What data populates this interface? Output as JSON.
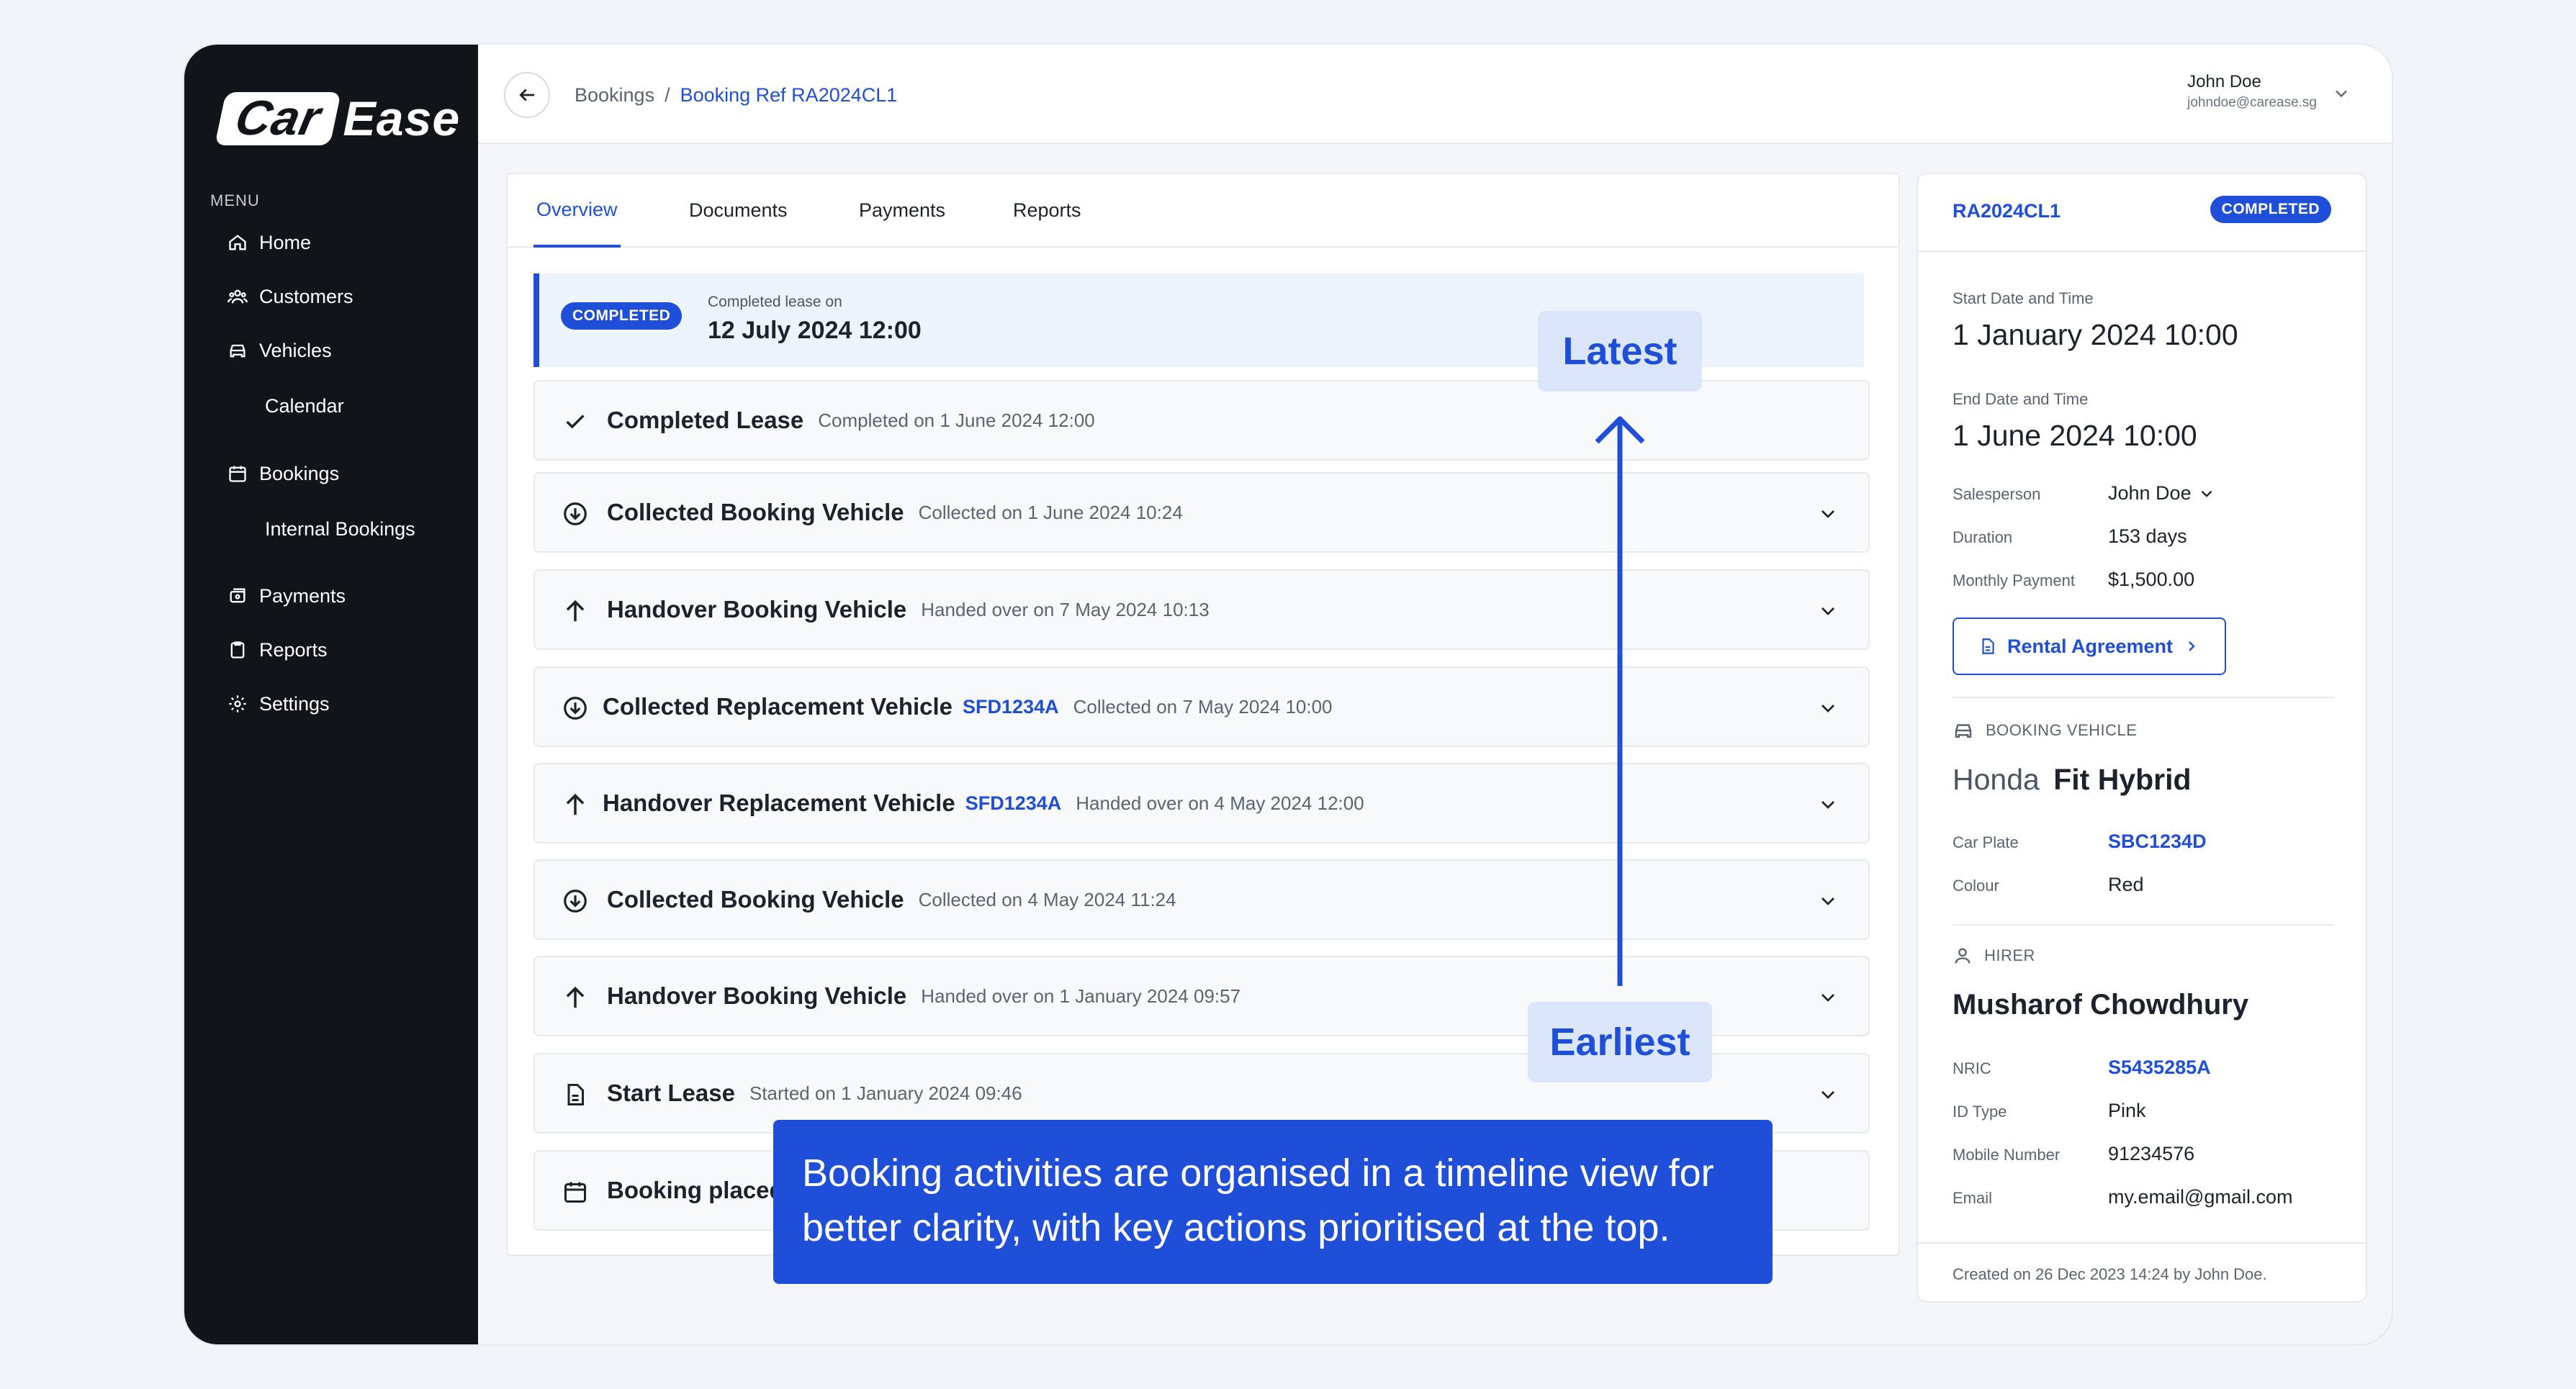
{
  "brand": {
    "car": "Car",
    "ease": "Ease"
  },
  "sidebar": {
    "menu_label": "MENU",
    "items": [
      {
        "label": "Home",
        "icon": "home-icon"
      },
      {
        "label": "Customers",
        "icon": "users-icon"
      },
      {
        "label": "Vehicles",
        "icon": "car-icon"
      },
      {
        "label": "Calendar"
      },
      {
        "label": "Bookings",
        "icon": "calendar-icon"
      },
      {
        "label": "Internal Bookings"
      },
      {
        "label": "Payments",
        "icon": "payments-icon"
      },
      {
        "label": "Reports",
        "icon": "clipboard-icon"
      },
      {
        "label": "Settings",
        "icon": "gear-icon"
      }
    ]
  },
  "header": {
    "breadcrumb": [
      "Bookings",
      "/",
      "Booking Ref RA2024CL1"
    ],
    "user_name": "John Doe",
    "user_email": "johndoe@carease.sg"
  },
  "tabs": [
    "Overview",
    "Documents",
    "Payments",
    "Reports"
  ],
  "status_banner": {
    "badge": "COMPLETED",
    "label": "Completed lease on",
    "date": "12 July 2024 12:00"
  },
  "activities": [
    {
      "icon": "check-icon",
      "title": "Completed Lease",
      "detail": "Completed on 1 June 2024 12:00"
    },
    {
      "icon": "collect-icon",
      "title": "Collected Booking Vehicle",
      "detail": "Collected on 1 June 2024 10:24"
    },
    {
      "icon": "arrow-up-icon",
      "title": "Handover Booking Vehicle",
      "detail": "Handed over on 7 May 2024 10:13"
    },
    {
      "icon": "collect-icon",
      "title": "Collected Replacement Vehicle",
      "plate": "SFD1234A",
      "detail": "Collected on 7 May 2024 10:00"
    },
    {
      "icon": "arrow-up-icon",
      "title": "Handover Replacement Vehicle",
      "plate": "SFD1234A",
      "detail": "Handed over on 4 May 2024 12:00"
    },
    {
      "icon": "collect-icon",
      "title": "Collected Booking Vehicle",
      "detail": "Collected on 4 May 2024 11:24"
    },
    {
      "icon": "arrow-up-icon",
      "title": "Handover Booking Vehicle",
      "detail": "Handed over on 1 January 2024 09:57"
    },
    {
      "icon": "document-icon",
      "title": "Start Lease",
      "detail": "Started on 1 January 2024 09:46"
    },
    {
      "icon": "calendar-icon",
      "title": "Booking placed"
    }
  ],
  "details": {
    "ref": "RA2024CL1",
    "badge": "COMPLETED",
    "start_label": "Start Date and Time",
    "start_value": "1 January 2024 10:00",
    "end_label": "End Date and Time",
    "end_value": "1 June 2024 10:00",
    "salesperson_label": "Salesperson",
    "salesperson_value": "John Doe",
    "duration_label": "Duration",
    "duration_value": "153 days",
    "monthly_label": "Monthly Payment",
    "monthly_value": "$1,500.00",
    "agreement_label": "Rental Agreement",
    "vehicle_section": "BOOKING VEHICLE",
    "vehicle_make": "Honda",
    "vehicle_model": "Fit Hybrid",
    "plate_label": "Car Plate",
    "plate_value": "SBC1234D",
    "colour_label": "Colour",
    "colour_value": "Red",
    "hirer_section": "HIRER",
    "hirer_name": "Musharof Chowdhury",
    "nric_label": "NRIC",
    "nric_value": "S5435285A",
    "idtype_label": "ID Type",
    "idtype_value": "Pink",
    "mobile_label": "Mobile Number",
    "mobile_value": "91234576",
    "email_label": "Email",
    "email_value": "my.email@gmail.com",
    "footer": "Created on 26 Dec 2023 14:24 by John Doe."
  },
  "annotations": {
    "latest": "Latest",
    "earliest": "Earliest",
    "callout": "Booking activities are organised in a timeline view for better clarity, with key actions prioritised at the top."
  },
  "colors": {
    "accent": "#1f4fd8",
    "sidebar": "#111418",
    "tag_bg": "#dbe6fb"
  }
}
